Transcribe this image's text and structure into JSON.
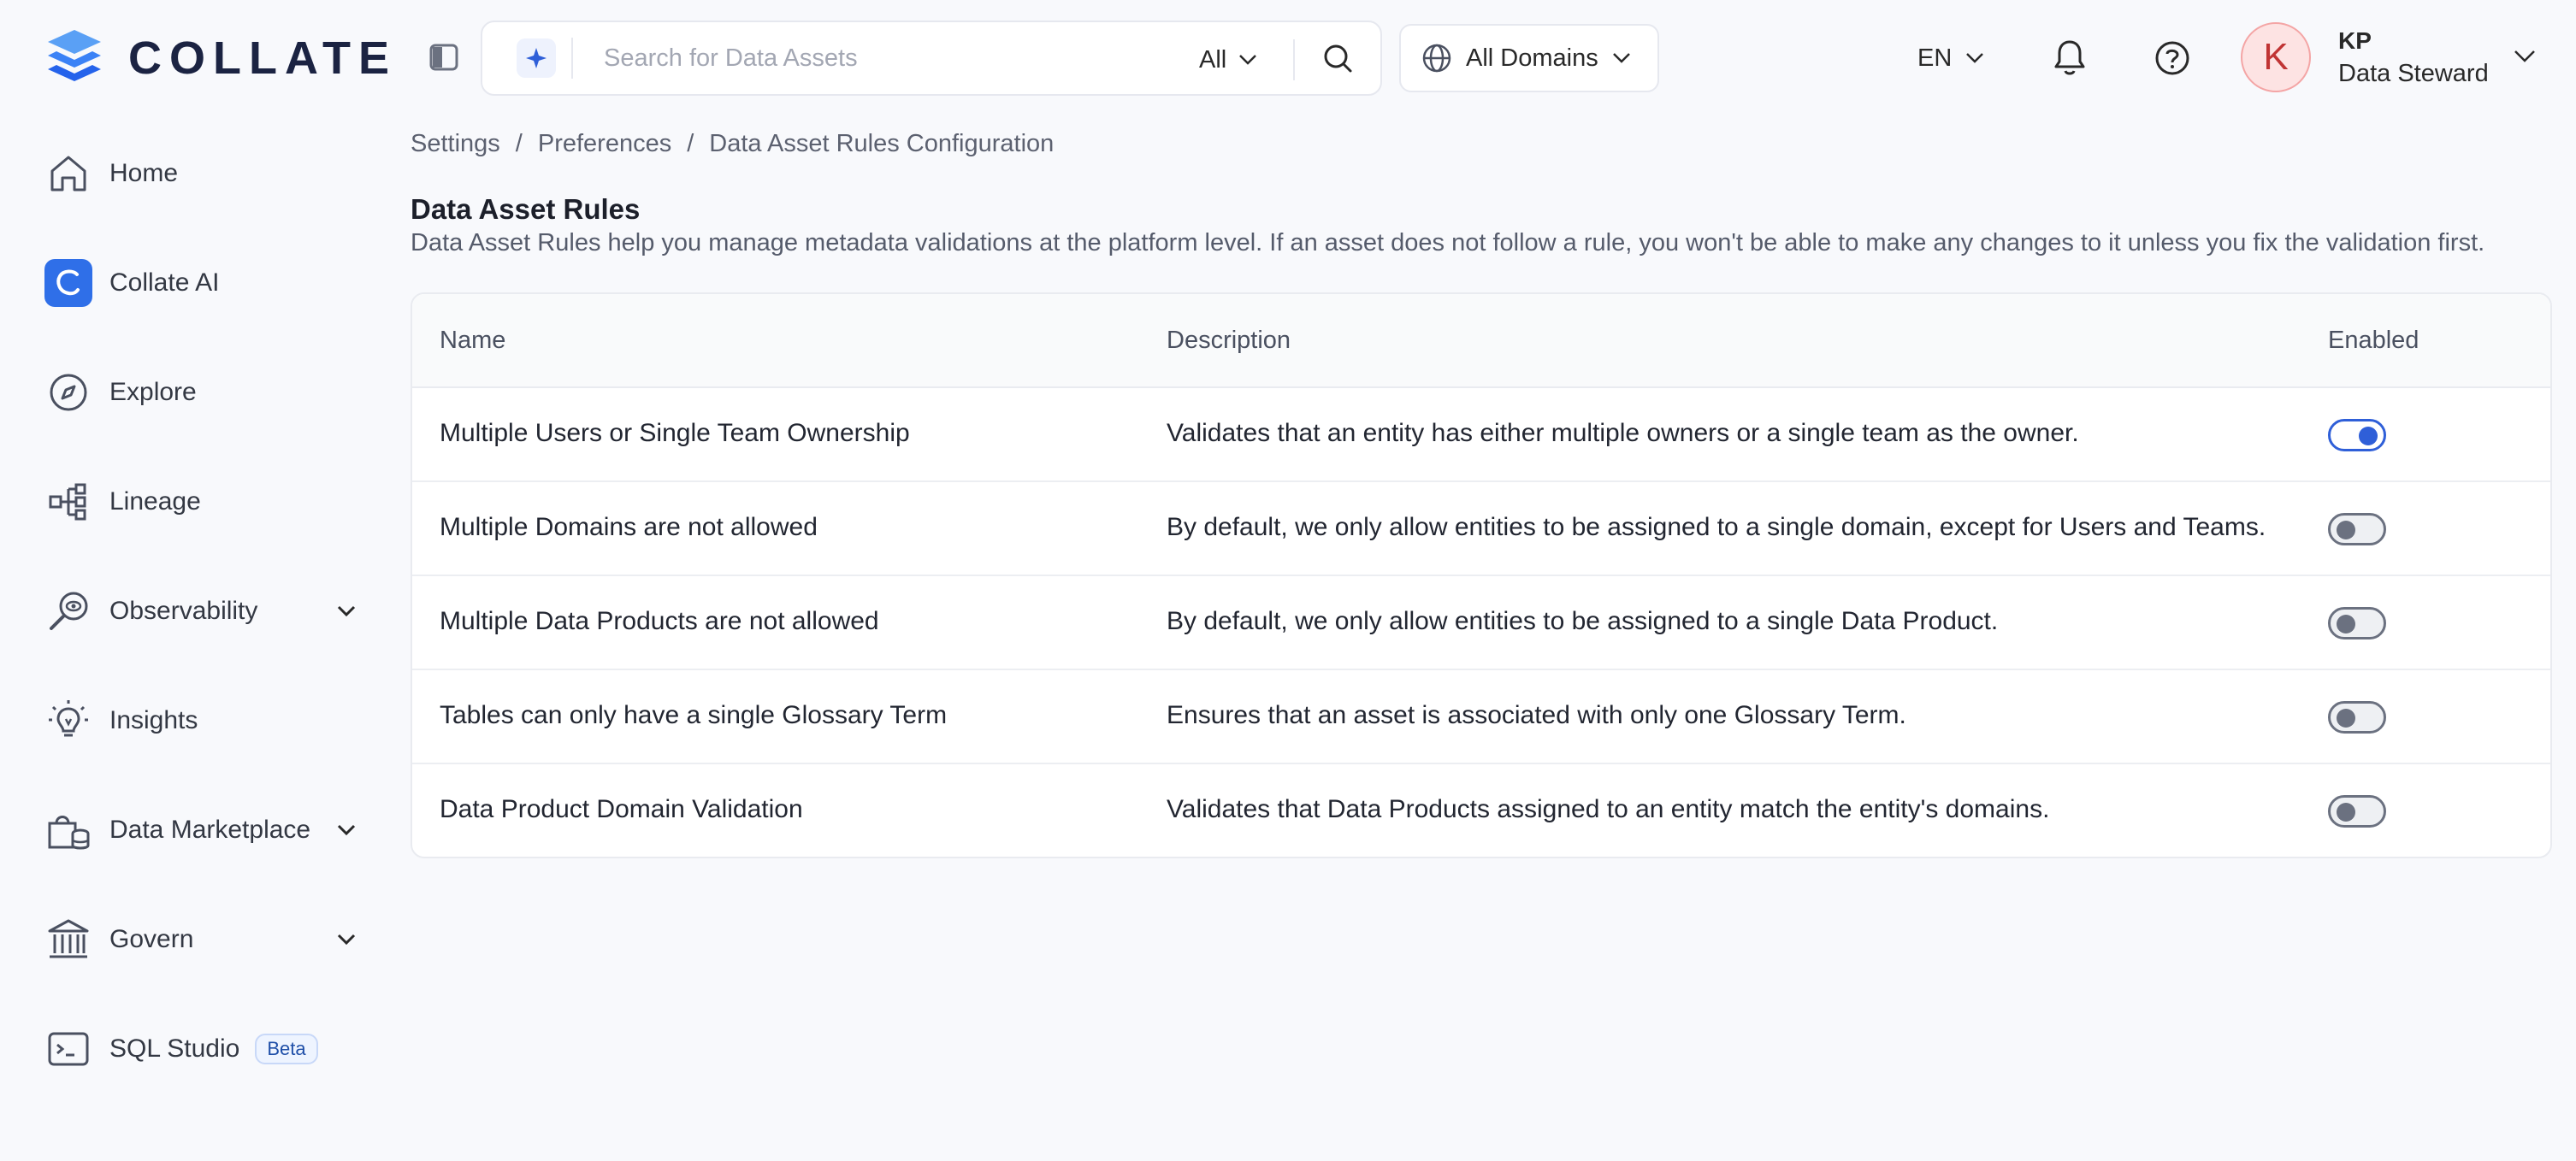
{
  "brand": {
    "name": "COLLATE",
    "accent": "#2f5fd8",
    "logo_colors": [
      "#3b82f6",
      "#1b2342"
    ]
  },
  "header": {
    "search_placeholder": "Search for Data Assets",
    "search_scope": "All",
    "domain_select": "All Domains",
    "language": "EN",
    "user": {
      "initial": "K",
      "name": "KP",
      "role": "Data Steward"
    },
    "icons": [
      "sidebar-toggle-icon",
      "ai-sparkle-icon",
      "search-icon",
      "globe-icon",
      "bell-icon",
      "help-icon",
      "chevron-down-icon"
    ]
  },
  "sidebar": {
    "items": [
      {
        "label": "Home",
        "icon": "home-icon",
        "expandable": false
      },
      {
        "label": "Collate AI",
        "icon": "collate-ai-icon",
        "expandable": false
      },
      {
        "label": "Explore",
        "icon": "compass-icon",
        "expandable": false
      },
      {
        "label": "Lineage",
        "icon": "lineage-icon",
        "expandable": false
      },
      {
        "label": "Observability",
        "icon": "observability-icon",
        "expandable": true
      },
      {
        "label": "Insights",
        "icon": "lightbulb-icon",
        "expandable": false
      },
      {
        "label": "Data Marketplace",
        "icon": "marketplace-icon",
        "expandable": true
      },
      {
        "label": "Govern",
        "icon": "bank-icon",
        "expandable": true
      },
      {
        "label": "SQL Studio",
        "icon": "terminal-icon",
        "expandable": false,
        "badge": "Beta"
      }
    ]
  },
  "breadcrumb": [
    "Settings",
    "Preferences",
    "Data Asset Rules Configuration"
  ],
  "page": {
    "title": "Data Asset Rules",
    "description": "Data Asset Rules help you manage metadata validations at the platform level. If an asset does not follow a rule, you won't be able to make any changes to it unless you fix the validation first."
  },
  "table": {
    "columns": [
      "Name",
      "Description",
      "Enabled"
    ],
    "rows": [
      {
        "name": "Multiple Users or Single Team Ownership",
        "description": "Validates that an entity has either multiple owners or a single team as the owner.",
        "enabled": true
      },
      {
        "name": "Multiple Domains are not allowed",
        "description": "By default, we only allow entities to be assigned to a single domain, except for Users and Teams.",
        "enabled": false
      },
      {
        "name": "Multiple Data Products are not allowed",
        "description": "By default, we only allow entities to be assigned to a single Data Product.",
        "enabled": false
      },
      {
        "name": "Tables can only have a single Glossary Term",
        "description": "Ensures that an asset is associated with only one Glossary Term.",
        "enabled": false
      },
      {
        "name": "Data Product Domain Validation",
        "description": "Validates that Data Products assigned to an entity match the entity's domains.",
        "enabled": false
      }
    ]
  }
}
